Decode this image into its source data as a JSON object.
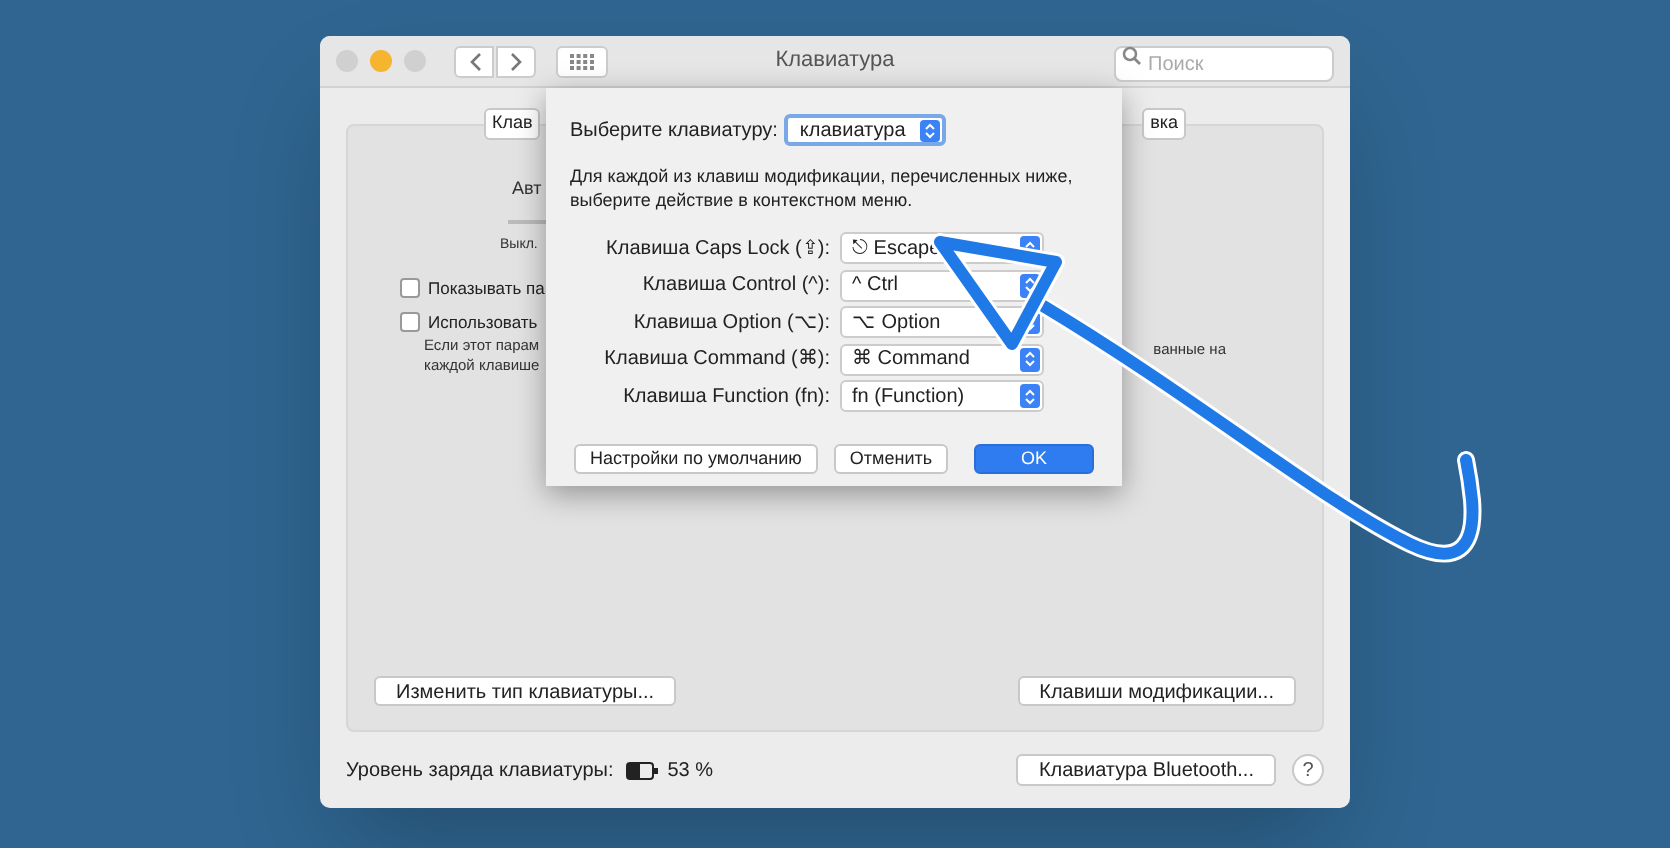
{
  "window": {
    "title": "Клавиатура",
    "search": {
      "placeholder": "Поиск"
    }
  },
  "background_panel": {
    "tabs": [
      {
        "label": "Клав",
        "selected": false
      },
      {
        "label": "вка",
        "selected": false
      }
    ],
    "texts": [
      "Авт",
      "Выкл."
    ],
    "checkboxes": [
      {
        "label": "Показывать па",
        "checked": false
      },
      {
        "label": "Использовать",
        "checked": false
      }
    ],
    "note_lines": [
      "Если этот парам",
      "каждой клавише"
    ],
    "note_right": "ванные на",
    "buttons": [
      "Изменить тип клавиатуры...",
      "Клавиши модификации..."
    ]
  },
  "status_bar": {
    "battery_label": "Уровень заряда клавиатуры:",
    "battery": {
      "level": 0.53
    },
    "battery_reading": "53 %",
    "bluetooth_button": "Клавиатура Bluetooth...",
    "help": "?"
  },
  "sheet": {
    "keyboard_label": "Выберите клавиатуру:",
    "keyboard_value": "клавиатура",
    "description": "Для каждой из клавиш модификации, перечисленных ниже, выберите действие в контекстном меню.",
    "rows": [
      {
        "label": "Клавиша Caps Lock (⇪):",
        "value": "⎋ Escape"
      },
      {
        "label": "Клавиша Control (^):",
        "value": "^ Ctrl"
      },
      {
        "label": "Клавиша Option (⌥):",
        "value": "⌥ Option"
      },
      {
        "label": "Клавиша Command (⌘):",
        "value": "⌘ Command"
      },
      {
        "label": "Клавиша Function (fn):",
        "value": "fn (Function)"
      }
    ],
    "buttons": [
      {
        "label": "Настройки по умолчанию",
        "default": false
      },
      {
        "label": "Отменить",
        "default": false
      },
      {
        "label": "OK",
        "default": true
      }
    ]
  }
}
